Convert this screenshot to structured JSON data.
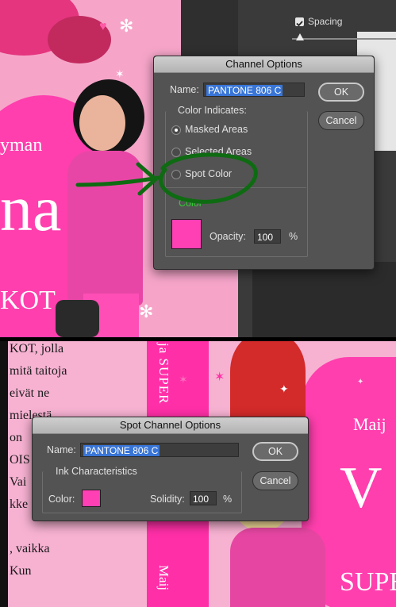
{
  "colors": {
    "swatch": "#ff3fb4",
    "annotation": "#0e6b12",
    "color_label_green": "#33cc33",
    "dialog_bg": "#535353"
  },
  "top_panel": {
    "background_text": {
      "line_yman": "yman",
      "line_na": "na",
      "line_kot": "KOT"
    },
    "spacing_checkbox": {
      "label": "Spacing",
      "checked": true
    },
    "channel_options": {
      "title": "Channel Options",
      "name_label": "Name:",
      "name_value": "PANTONE 806 C",
      "ok_label": "OK",
      "cancel_label": "Cancel",
      "color_indicates_label": "Color Indicates:",
      "options": [
        {
          "label": "Masked Areas",
          "selected": true
        },
        {
          "label": "Selected Areas",
          "selected": false
        },
        {
          "label": "Spot Color",
          "selected": false
        }
      ],
      "color_label": "Color",
      "opacity_label": "Opacity:",
      "opacity_value": "100",
      "opacity_unit": "%"
    }
  },
  "bottom_panel": {
    "background_text": {
      "lines_left": [
        "KOT, jolla",
        "mitä taitoja",
        "eivät ne",
        "mielestä",
        "on",
        "OIS",
        "Vai",
        "kke",
        ", vaikka",
        "Kun"
      ],
      "vertical_1": "ja SUPER",
      "vertical_2": "Maij",
      "right_maij": "Maij",
      "right_v": "V",
      "right_super": "SUPER"
    },
    "spot_channel_options": {
      "title": "Spot Channel Options",
      "name_label": "Name:",
      "name_value": "PANTONE 806 C",
      "ok_label": "OK",
      "cancel_label": "Cancel",
      "ink_label": "Ink Characteristics",
      "color_label": "Color:",
      "solidity_label": "Solidity:",
      "solidity_value": "100",
      "solidity_unit": "%"
    }
  }
}
